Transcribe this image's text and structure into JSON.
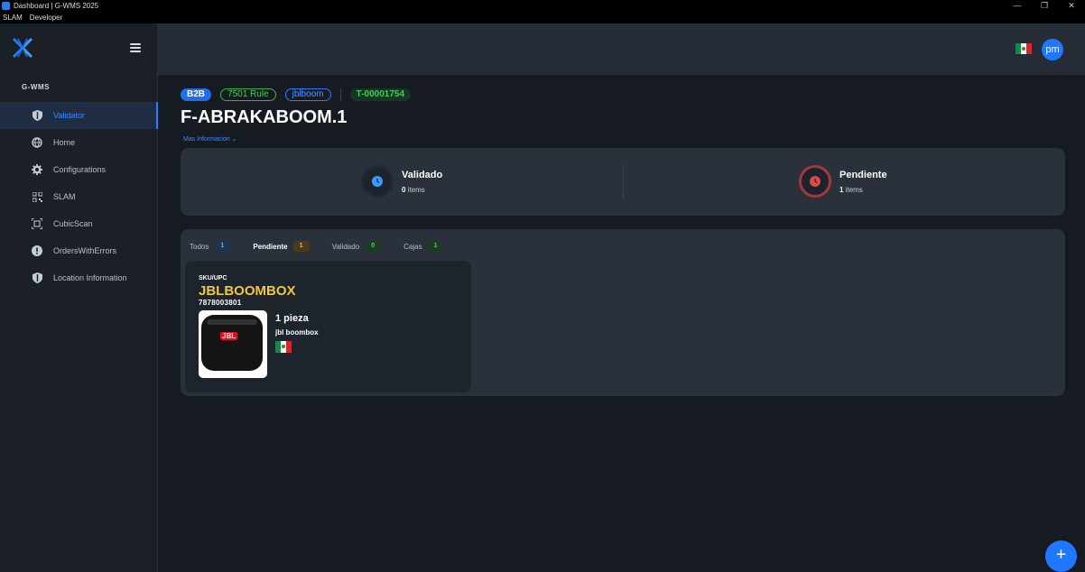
{
  "window": {
    "title": "Dashboard | G-WMS 2025",
    "minimize": "—",
    "maximize": "❐",
    "close": "✕"
  },
  "menubar": {
    "items": [
      "SLAM",
      "Developer"
    ]
  },
  "sidebar": {
    "brand": "G-WMS",
    "items": [
      {
        "label": "Validator",
        "icon": "shield-icon",
        "active": true
      },
      {
        "label": "Home",
        "icon": "globe-icon"
      },
      {
        "label": "Configurations",
        "icon": "gear-icon"
      },
      {
        "label": "SLAM",
        "icon": "qr-icon"
      },
      {
        "label": "CubicScan",
        "icon": "scan-icon"
      },
      {
        "label": "OrdersWithErrors",
        "icon": "alert-icon"
      },
      {
        "label": "Location Information",
        "icon": "shield-icon"
      }
    ]
  },
  "topbar": {
    "avatar": "pm",
    "flag": "mexico-flag-icon"
  },
  "order": {
    "badges": {
      "type": "B2B",
      "rule": "7501 Rule",
      "customer": "jblboom",
      "ticket": "T-00001754"
    },
    "title": "F-ABRAKABOOM.1",
    "more_info": "Mas Informacion ⌄"
  },
  "summary": {
    "validado": {
      "label": "Validado",
      "count": "0",
      "unit": "items"
    },
    "pendiente": {
      "label": "Pendiente",
      "count": "1",
      "unit": "items"
    }
  },
  "tabs": [
    {
      "label": "Todos",
      "count": "1"
    },
    {
      "label": "Pendiente",
      "count": "1",
      "active": true
    },
    {
      "label": "Validado",
      "count": "0"
    },
    {
      "label": "Cajas",
      "count": "1"
    }
  ],
  "item_card": {
    "sku_label": "SKU/UPC",
    "sku": "JBLBOOMBOX",
    "upc": "7878003801",
    "quantity": "1 pieza",
    "description": "jbl boombox",
    "image_brand": "JBL"
  },
  "fab": {
    "label": "+"
  },
  "colors": {
    "accent": "#1f78ff",
    "sku": "#f0c73f",
    "pending": "#d8262f",
    "success": "#3fcf56"
  }
}
